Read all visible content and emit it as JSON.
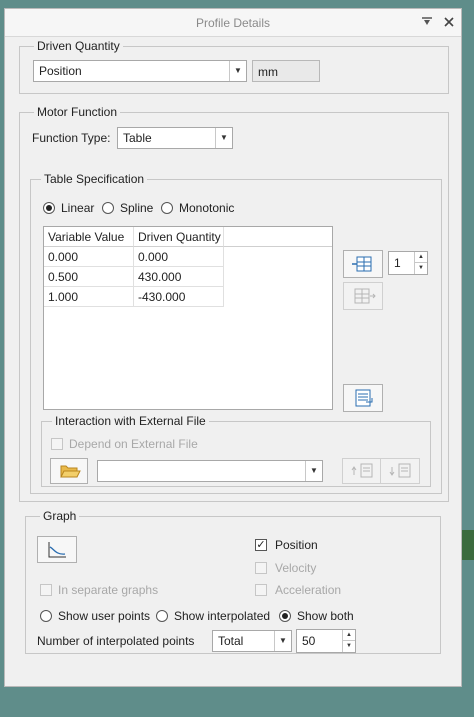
{
  "window": {
    "title": "Profile Details",
    "pin_icon": "pin-icon",
    "close_icon": "close-icon"
  },
  "driven_quantity": {
    "legend": "Driven Quantity",
    "selected": "Position",
    "unit": "mm"
  },
  "motor_function": {
    "legend": "Motor Function",
    "function_type_label": "Function Type:",
    "function_type_value": "Table",
    "table_spec": {
      "legend": "Table Specification",
      "interpolation_options": [
        "Linear",
        "Spline",
        "Monotonic"
      ],
      "selected_interpolation": "Linear",
      "columns": [
        "Variable Value",
        "Driven Quantity"
      ],
      "rows": [
        [
          "0.000",
          "0.000"
        ],
        [
          "0.500",
          "430.000"
        ],
        [
          "1.000",
          "-430.000"
        ]
      ],
      "row_count_value": "1"
    },
    "external_file": {
      "legend": "Interaction with External File",
      "depend_label": "Depend on External File",
      "depend_checked": false,
      "file_path": ""
    }
  },
  "graph": {
    "legend": "Graph",
    "position_label": "Position",
    "position_checked": true,
    "velocity_label": "Velocity",
    "velocity_checked": false,
    "acceleration_label": "Acceleration",
    "acceleration_checked": false,
    "separate_graphs_label": "In separate graphs",
    "separate_graphs_checked": false,
    "point_options": [
      "Show user points",
      "Show interpolated",
      "Show both"
    ],
    "selected_point_option": "Show both",
    "interp_points_label": "Number of interpolated points",
    "interp_points_mode": "Total",
    "interp_points_value": "50"
  }
}
